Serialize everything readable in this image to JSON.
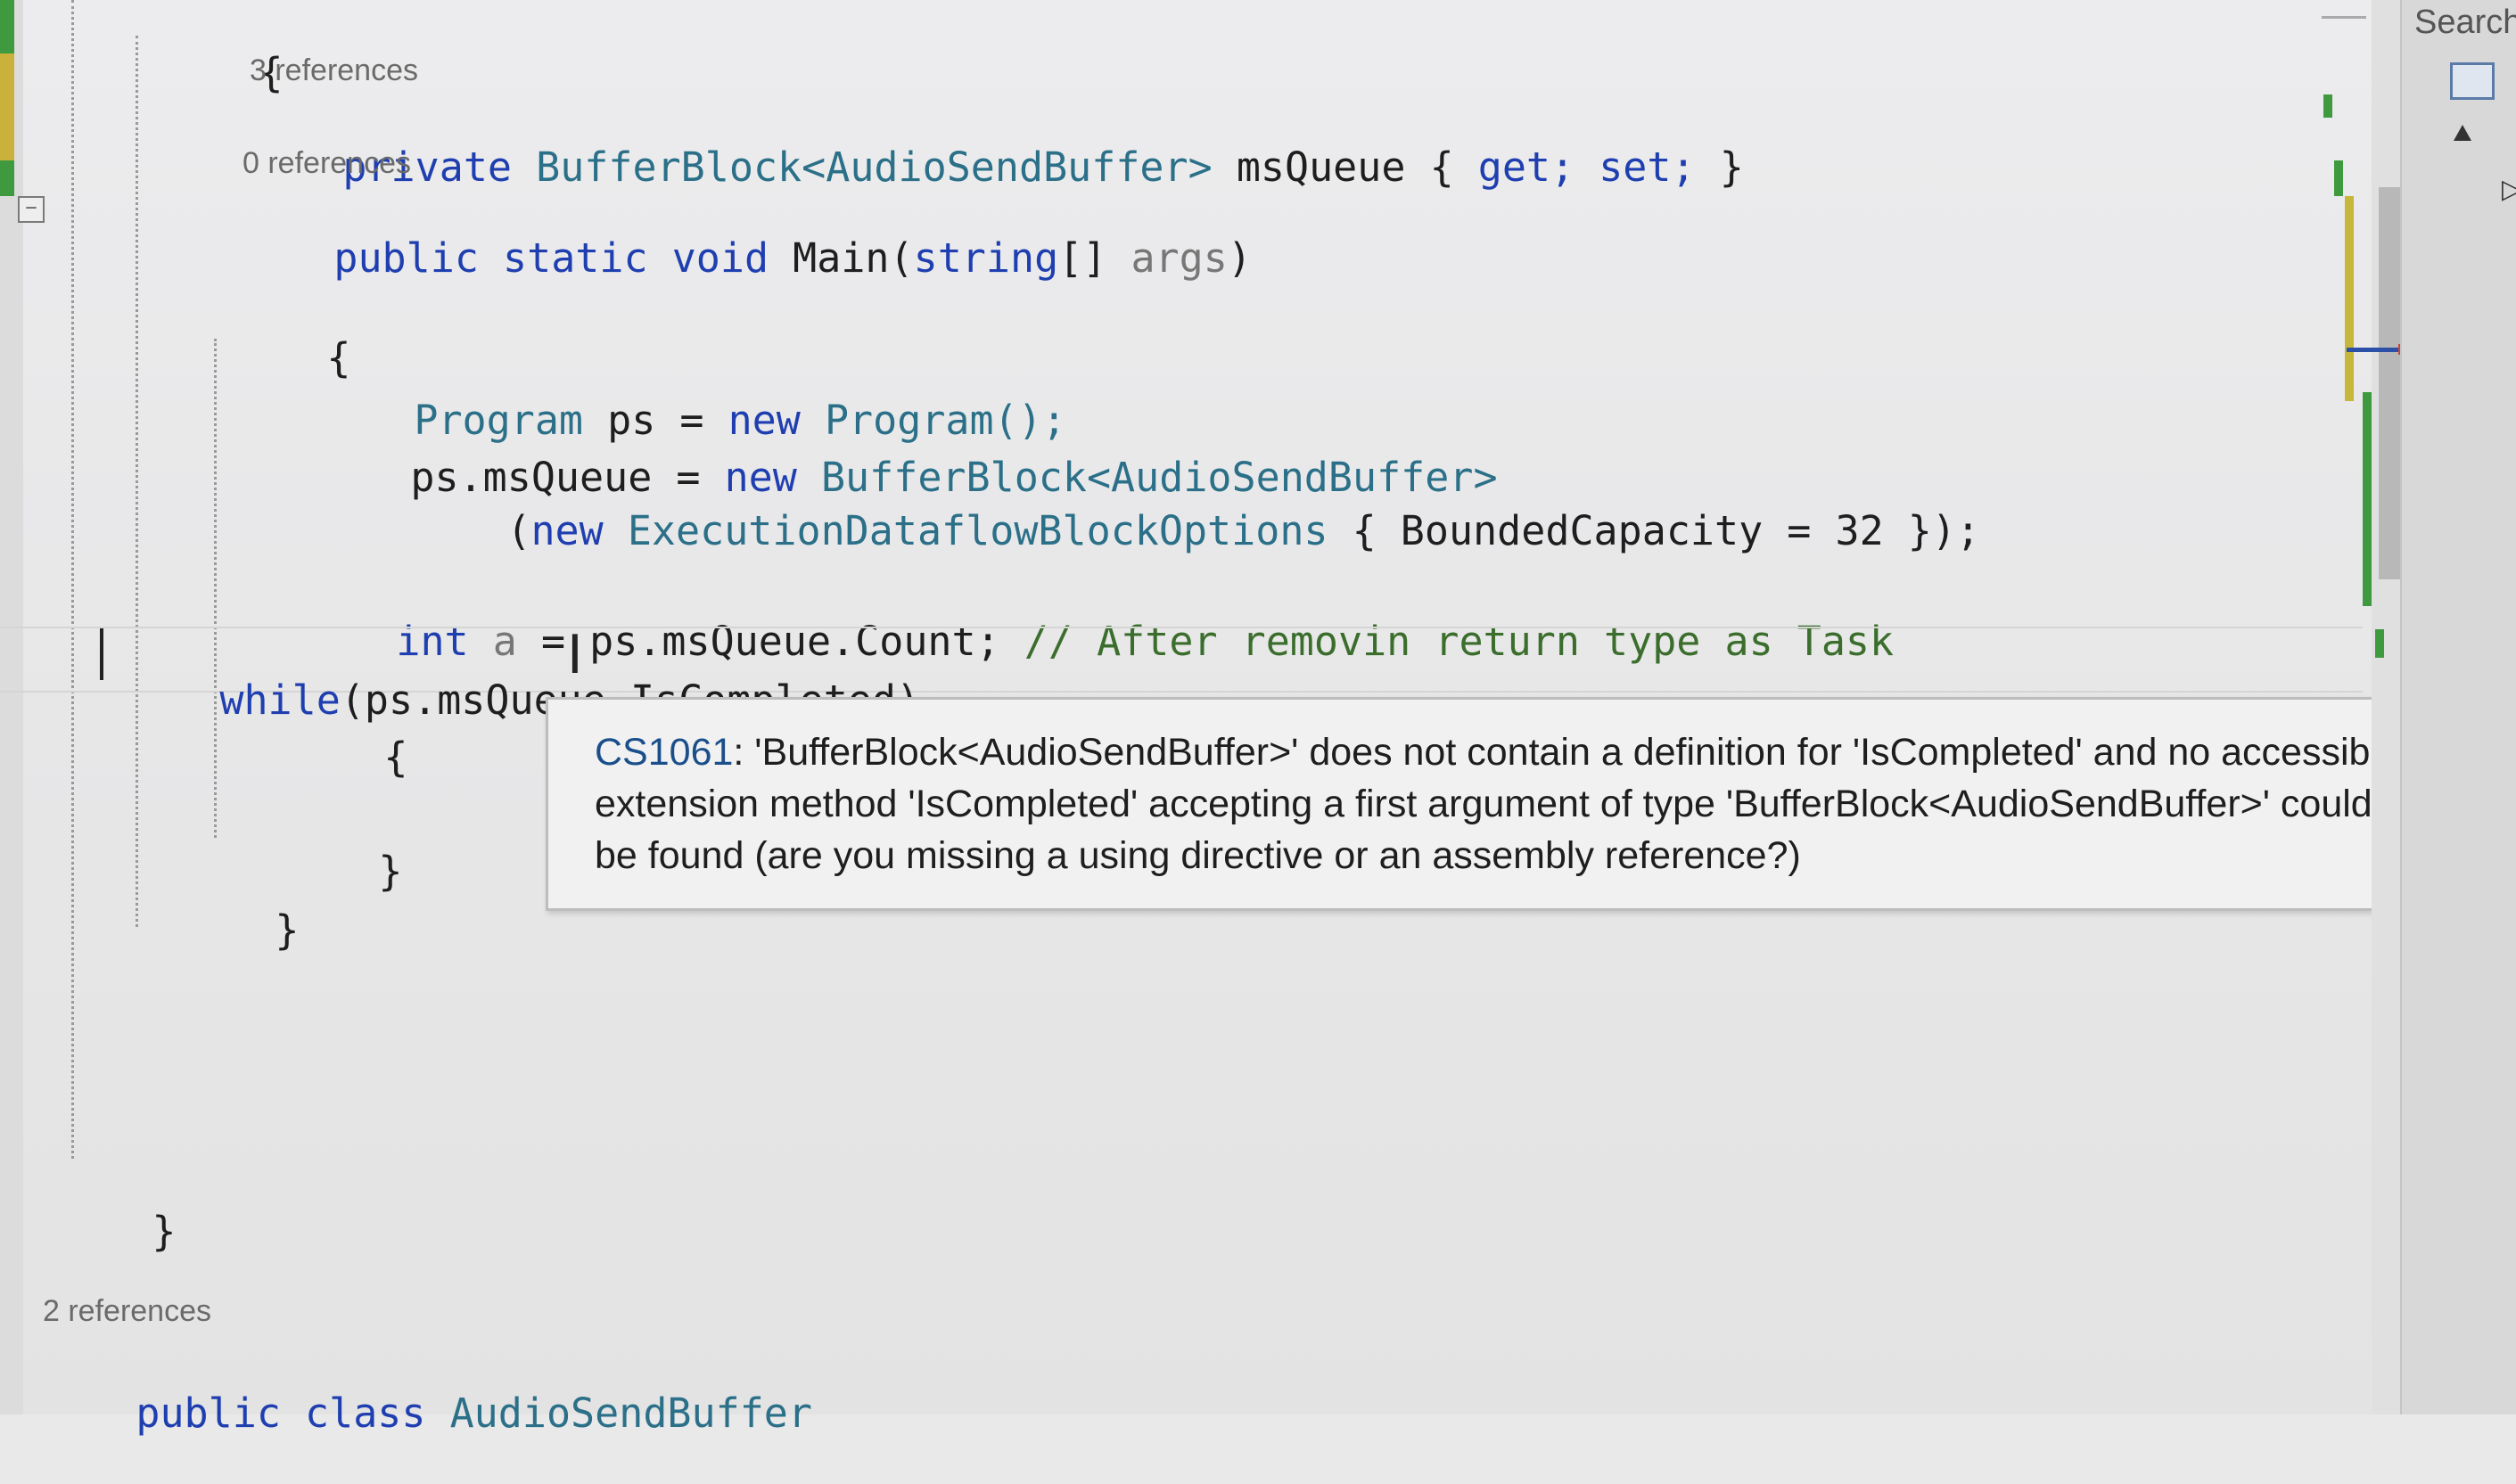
{
  "editor": {
    "lines": {
      "open_brace_top": "{",
      "ref_msqueue": "3 references",
      "field_private": "private",
      "field_type": "BufferBlock<AudioSendBuffer>",
      "field_name": "msQueue",
      "field_open": "{",
      "field_get": "get;",
      "field_set": "set;",
      "field_close": "}",
      "ref_main": "0 references",
      "main_public": "public",
      "main_static": "static",
      "main_void": "void",
      "main_name": "Main(",
      "main_string": "string",
      "main_arr": "[]",
      "main_args": "args",
      "main_close": ")",
      "main_open_brace": "{",
      "l1_type": "Program",
      "l1_rest": "ps =",
      "l1_new": "new",
      "l1_ctor": "Program();",
      "l2_lhs": "ps.msQueue =",
      "l2_new": "new",
      "l2_type": "BufferBlock<AudioSendBuffer>",
      "l3_open": "(",
      "l3_new": "new",
      "l3_type": "ExecutionDataflowBlockOptions",
      "l3_rest": "{ BoundedCapacity = 32 });",
      "l4_int": "int",
      "l4_var": "a",
      "l4_rest": "= ps.msQueue.Count;",
      "l4_comment": "// After removin return type as Task",
      "while_kw": "while",
      "while_expr_a": "(ps.msQueue.",
      "while_member": "IsCompleted",
      "while_close": ")",
      "while_open_brace": "{",
      "while_close_brace": "}",
      "main_close_brace": "}",
      "class_close_brace": "}",
      "ref_class": "2 references",
      "class_public": "public",
      "class_kw": "class",
      "class_name": "AudioSendBuffer"
    }
  },
  "tooltip": {
    "error_code": "CS1061",
    "message": ": 'BufferBlock<AudioSendBuffer>' does not contain a definition for 'IsCompleted' and no accessible extension method 'IsCompleted' accepting a first argument of type 'BufferBlock<AudioSendBuffer>' could be found (are you missing a using directive or an assembly reference?)"
  },
  "right_panel": {
    "search_label": "Search"
  }
}
